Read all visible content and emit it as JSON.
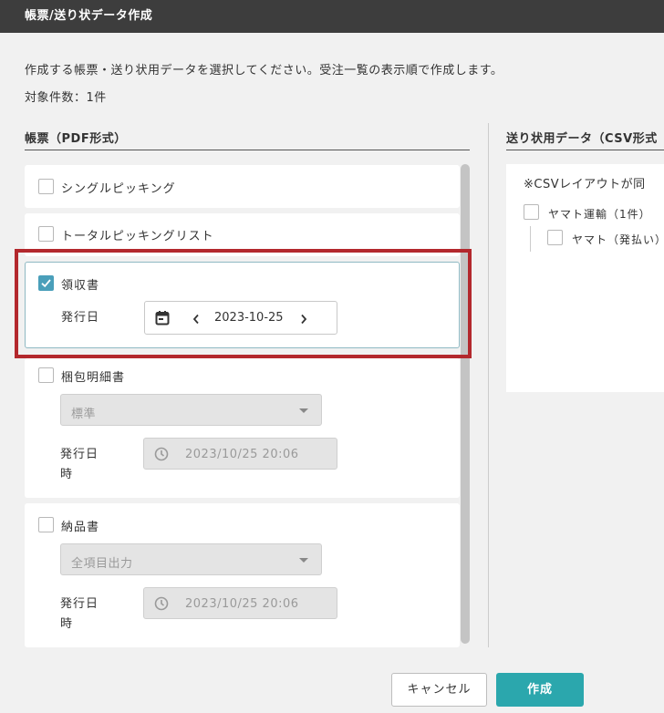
{
  "window": {
    "title": "帳票/送り状データ作成"
  },
  "description": "作成する帳票・送り状用データを選択してください。受注一覧の表示順で作成します。",
  "target_count": "対象件数：1件",
  "left_section": {
    "title": "帳票（PDF形式）",
    "single_picking": {
      "label": "シングルピッキング",
      "checked": false
    },
    "total_picking": {
      "label": "トータルピッキングリスト",
      "checked": false
    },
    "receipt": {
      "label": "領収書",
      "checked": true,
      "issue_date_label": "発行日",
      "date_value": "2023-10-25"
    },
    "packing_slip": {
      "label": "梱包明細書",
      "checked": false,
      "select_value": "標準",
      "issue_datetime_label_1": "発行日",
      "issue_datetime_label_2": "時",
      "datetime_value": "2023/10/25 20:06"
    },
    "delivery_note": {
      "label": "納品書",
      "checked": false,
      "select_value": "全項目出力",
      "issue_datetime_label_1": "発行日",
      "issue_datetime_label_2": "時",
      "datetime_value": "2023/10/25 20:06"
    }
  },
  "right_section": {
    "title": "送り状用データ（CSV形式",
    "note": "※CSVレイアウトが同",
    "yamato_parent": {
      "label": "ヤマト運輸（1件）",
      "checked": false
    },
    "yamato_child": {
      "label": "ヤマト（発払い）",
      "checked": false
    }
  },
  "footer": {
    "cancel_label": "キャンセル",
    "create_label": "作成"
  },
  "colors": {
    "accent": "#2ba7ad",
    "checkbox_checked": "#4a9fba",
    "highlight": "#b3282d",
    "titlebar": "#3d3d3d"
  }
}
